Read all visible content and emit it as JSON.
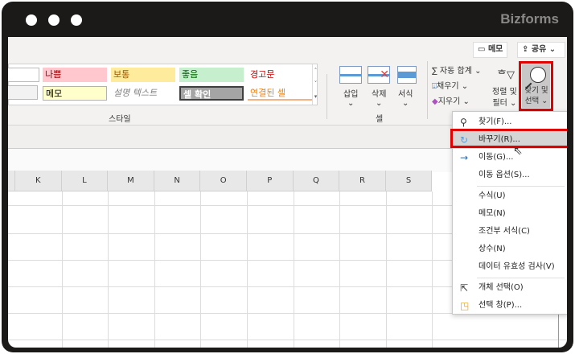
{
  "brand": "Bizforms",
  "top_buttons": {
    "memo": "메모",
    "share": "공유"
  },
  "styles": {
    "cells": [
      {
        "label": "나쁨",
        "bg": "#ffc7ce",
        "color": "#9c0006"
      },
      {
        "label": "보통",
        "bg": "#ffeb9c",
        "color": "#9c5700"
      },
      {
        "label": "좋음",
        "bg": "#c6efce",
        "color": "#006100"
      },
      {
        "label": "경고문",
        "bg": "#ffffff",
        "color": "#c00000"
      },
      {
        "label": "메모",
        "bg": "#ffffcc",
        "color": "#222222"
      },
      {
        "label": "설명 텍스트",
        "bg": "#ffffff",
        "color": "#7f7f7f"
      },
      {
        "label": "셀 확인",
        "bg": "#a5a5a5",
        "color": "#ffffff"
      },
      {
        "label": "연결된 셀",
        "bg": "#ffffff",
        "color": "#fa7d00"
      }
    ],
    "group_label": "스타일"
  },
  "cells_group": {
    "insert": "삽입",
    "delete": "삭제",
    "format": "서식",
    "group_label": "셀"
  },
  "editing": {
    "autosum": "자동 합계",
    "fill": "채우기",
    "clear": "지우기",
    "sort_filter_1": "정렬 및",
    "sort_filter_2": "필터",
    "find_select_1": "찾기 및",
    "find_select_2": "선택"
  },
  "columns": [
    "K",
    "L",
    "M",
    "N",
    "O",
    "P",
    "Q",
    "R",
    "S"
  ],
  "menu": {
    "items": [
      {
        "label": "찾기(F)...",
        "icon": "search-icon"
      },
      {
        "label": "바꾸기(R)...",
        "icon": "replace-icon"
      },
      {
        "label": "이동(G)...",
        "icon": "arrow-right-icon"
      },
      {
        "label": "이동 옵션(S)..."
      },
      {
        "label": "수식(U)"
      },
      {
        "label": "메모(N)"
      },
      {
        "label": "조건부 서식(C)"
      },
      {
        "label": "상수(N)"
      },
      {
        "label": "데이터 유효성 검사(V)"
      },
      {
        "label": "개체 선택(O)",
        "icon": "pointer-icon"
      },
      {
        "label": "선택 창(P)...",
        "icon": "selection-pane-icon"
      }
    ]
  },
  "accent": "#e00000"
}
